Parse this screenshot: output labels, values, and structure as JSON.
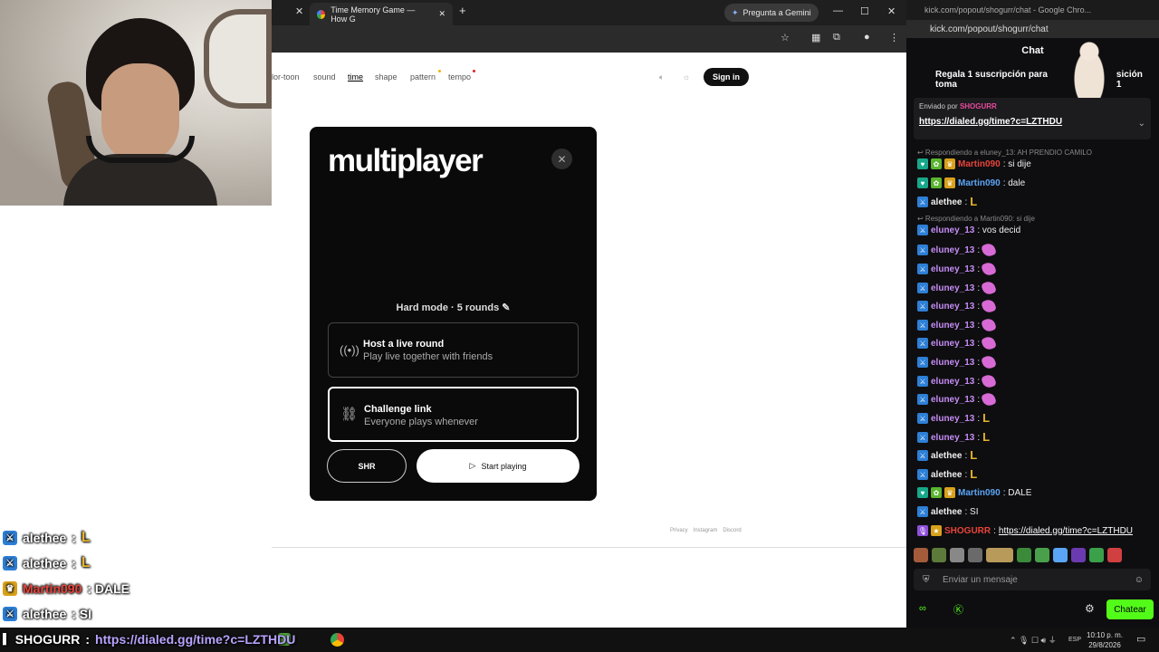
{
  "browser": {
    "tab_title": "Time Memory Game — How G",
    "gemini_label": "Pregunta a Gemini",
    "nav": [
      "lor-toon",
      "sound",
      "time",
      "shape",
      "pattern",
      "tempo"
    ],
    "signin": "Sign in"
  },
  "modal": {
    "title": "multiplayer",
    "mode": "Hard mode · 5 rounds",
    "host_title": "Host a live round",
    "host_sub": "Play live together with friends",
    "link_title": "Challenge link",
    "link_sub": "Everyone plays whenever",
    "shr_label": "SHR",
    "start_label": "Start playing"
  },
  "footer_links": [
    "Privacy",
    "Instagram",
    "Discord"
  ],
  "chat": {
    "window_title": "kick.com/popout/shogurr/chat - Google Chro...",
    "url": "kick.com/popout/shogurr/chat",
    "header": "Chat",
    "sub_banner": "Regala 1 suscripción para toma",
    "sub_banner_tail": "sición 1",
    "pinned_by": "Enviado por",
    "pinned_user": "SHOGURR",
    "pinned_link": "https://dialed.gg/time?c=LZTHDU",
    "reply1": "↩ Respondiendo a eluney_13: AH PRENDIO CAMILO",
    "reply2": "↩ Respondiendo a Martin090: si dije",
    "input_placeholder": "Enviar un mensaje",
    "send_label": "Chatear",
    "colors": {
      "eluney": "#c58cf5",
      "martin": "#e8443a",
      "martin2": "#5aa5f5",
      "alethee": "#ffffff",
      "shogurr": "#e8443a",
      "kick_green": "#53fc18"
    }
  },
  "messages": [
    {
      "user": "Martin090",
      "text": ": si dije"
    },
    {
      "user": "Martin090",
      "text": ": dale"
    },
    {
      "user": "alethee",
      "text": ":"
    },
    {
      "user": "eluney_13",
      "text": ": vos decid"
    },
    {
      "user": "eluney_13",
      "text": ":"
    },
    {
      "user": "eluney_13",
      "text": ":"
    },
    {
      "user": "eluney_13",
      "text": ":"
    },
    {
      "user": "eluney_13",
      "text": ":"
    },
    {
      "user": "eluney_13",
      "text": ":"
    },
    {
      "user": "eluney_13",
      "text": ":"
    },
    {
      "user": "eluney_13",
      "text": ":"
    },
    {
      "user": "eluney_13",
      "text": ":"
    },
    {
      "user": "eluney_13",
      "text": ":"
    },
    {
      "user": "eluney_13",
      "text": ":"
    },
    {
      "user": "eluney_13",
      "text": ":"
    },
    {
      "user": "alethee",
      "text": ":"
    },
    {
      "user": "alethee",
      "text": ":"
    },
    {
      "user": "Martin090",
      "text": ": DALE"
    },
    {
      "user": "alethee",
      "text": ": SI"
    },
    {
      "user": "SHOGURR",
      "text": ":"
    },
    {
      "user": "SHOGURR",
      "text": "https://dialed.gg/time?c=LZTHDU"
    }
  ],
  "overlay": [
    {
      "user": "alethee",
      "text": ":"
    },
    {
      "user": "alethee",
      "text": ":"
    },
    {
      "user": "Martin090",
      "text": ": DALE"
    },
    {
      "user": "alethee",
      "text": ": SI"
    },
    {
      "user": "SHOGURR",
      "text": ":"
    },
    {
      "user": "SHOGURR",
      "text": "https://dialed.gg/time?c=LZTHDU"
    }
  ],
  "taskbar": {
    "lang": "ESP",
    "time": "10:10 p. m.",
    "date": "29/8/2026"
  }
}
